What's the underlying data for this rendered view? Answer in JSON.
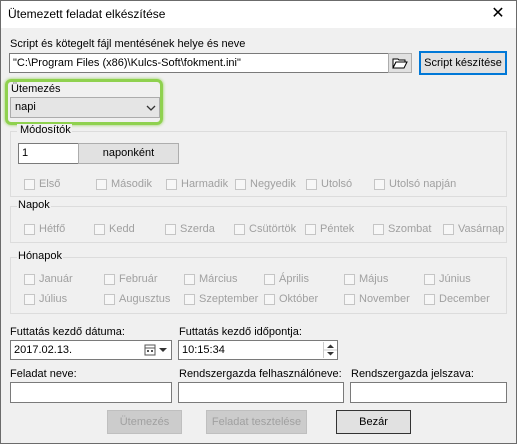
{
  "window": {
    "title": "Ütemezett feladat elkészítése",
    "close_glyph": "✕"
  },
  "script": {
    "label": "Script és kötegelt fájl mentésének helye és neve",
    "path_value": "\"C:\\Program Files (x86)\\Kulcs-Soft\\fokment.ini\"",
    "create_button": "Script készítése"
  },
  "schedule": {
    "label": "Ütemezés",
    "selected": "napi"
  },
  "modifiers": {
    "title": "Módosítók",
    "interval_value": "1",
    "interval_unit": "naponként",
    "options": [
      "Első",
      "Második",
      "Harmadik",
      "Negyedik",
      "Utolsó",
      "Utolsó napján"
    ]
  },
  "days": {
    "title": "Napok",
    "items": [
      "Hétfő",
      "Kedd",
      "Szerda",
      "Csütörtök",
      "Péntek",
      "Szombat",
      "Vasárnap"
    ]
  },
  "months": {
    "title": "Hónapok",
    "row1": [
      "Január",
      "Február",
      "Március",
      "Április",
      "Május",
      "Június"
    ],
    "row2": [
      "Július",
      "Augusztus",
      "Szeptember",
      "Október",
      "November",
      "December"
    ]
  },
  "start": {
    "date_label": "Futtatás kezdő dátuma:",
    "date_value": "2017.02.13.",
    "time_label": "Futtatás kezdő időpontja:",
    "time_value": "10:15:34"
  },
  "fields": {
    "task_name_label": "Feladat neve:",
    "task_name_value": "",
    "admin_user_label": "Rendszergazda felhasználóneve:",
    "admin_user_value": "",
    "admin_pass_label": "Rendszergazda jelszava:",
    "admin_pass_value": ""
  },
  "buttons": {
    "schedule": "Ütemezés",
    "test": "Feladat tesztelése",
    "close": "Bezár"
  },
  "colors": {
    "highlight": "#8fd14f",
    "accent": "#0078d7",
    "disabled_text": "#a0a0a0"
  }
}
